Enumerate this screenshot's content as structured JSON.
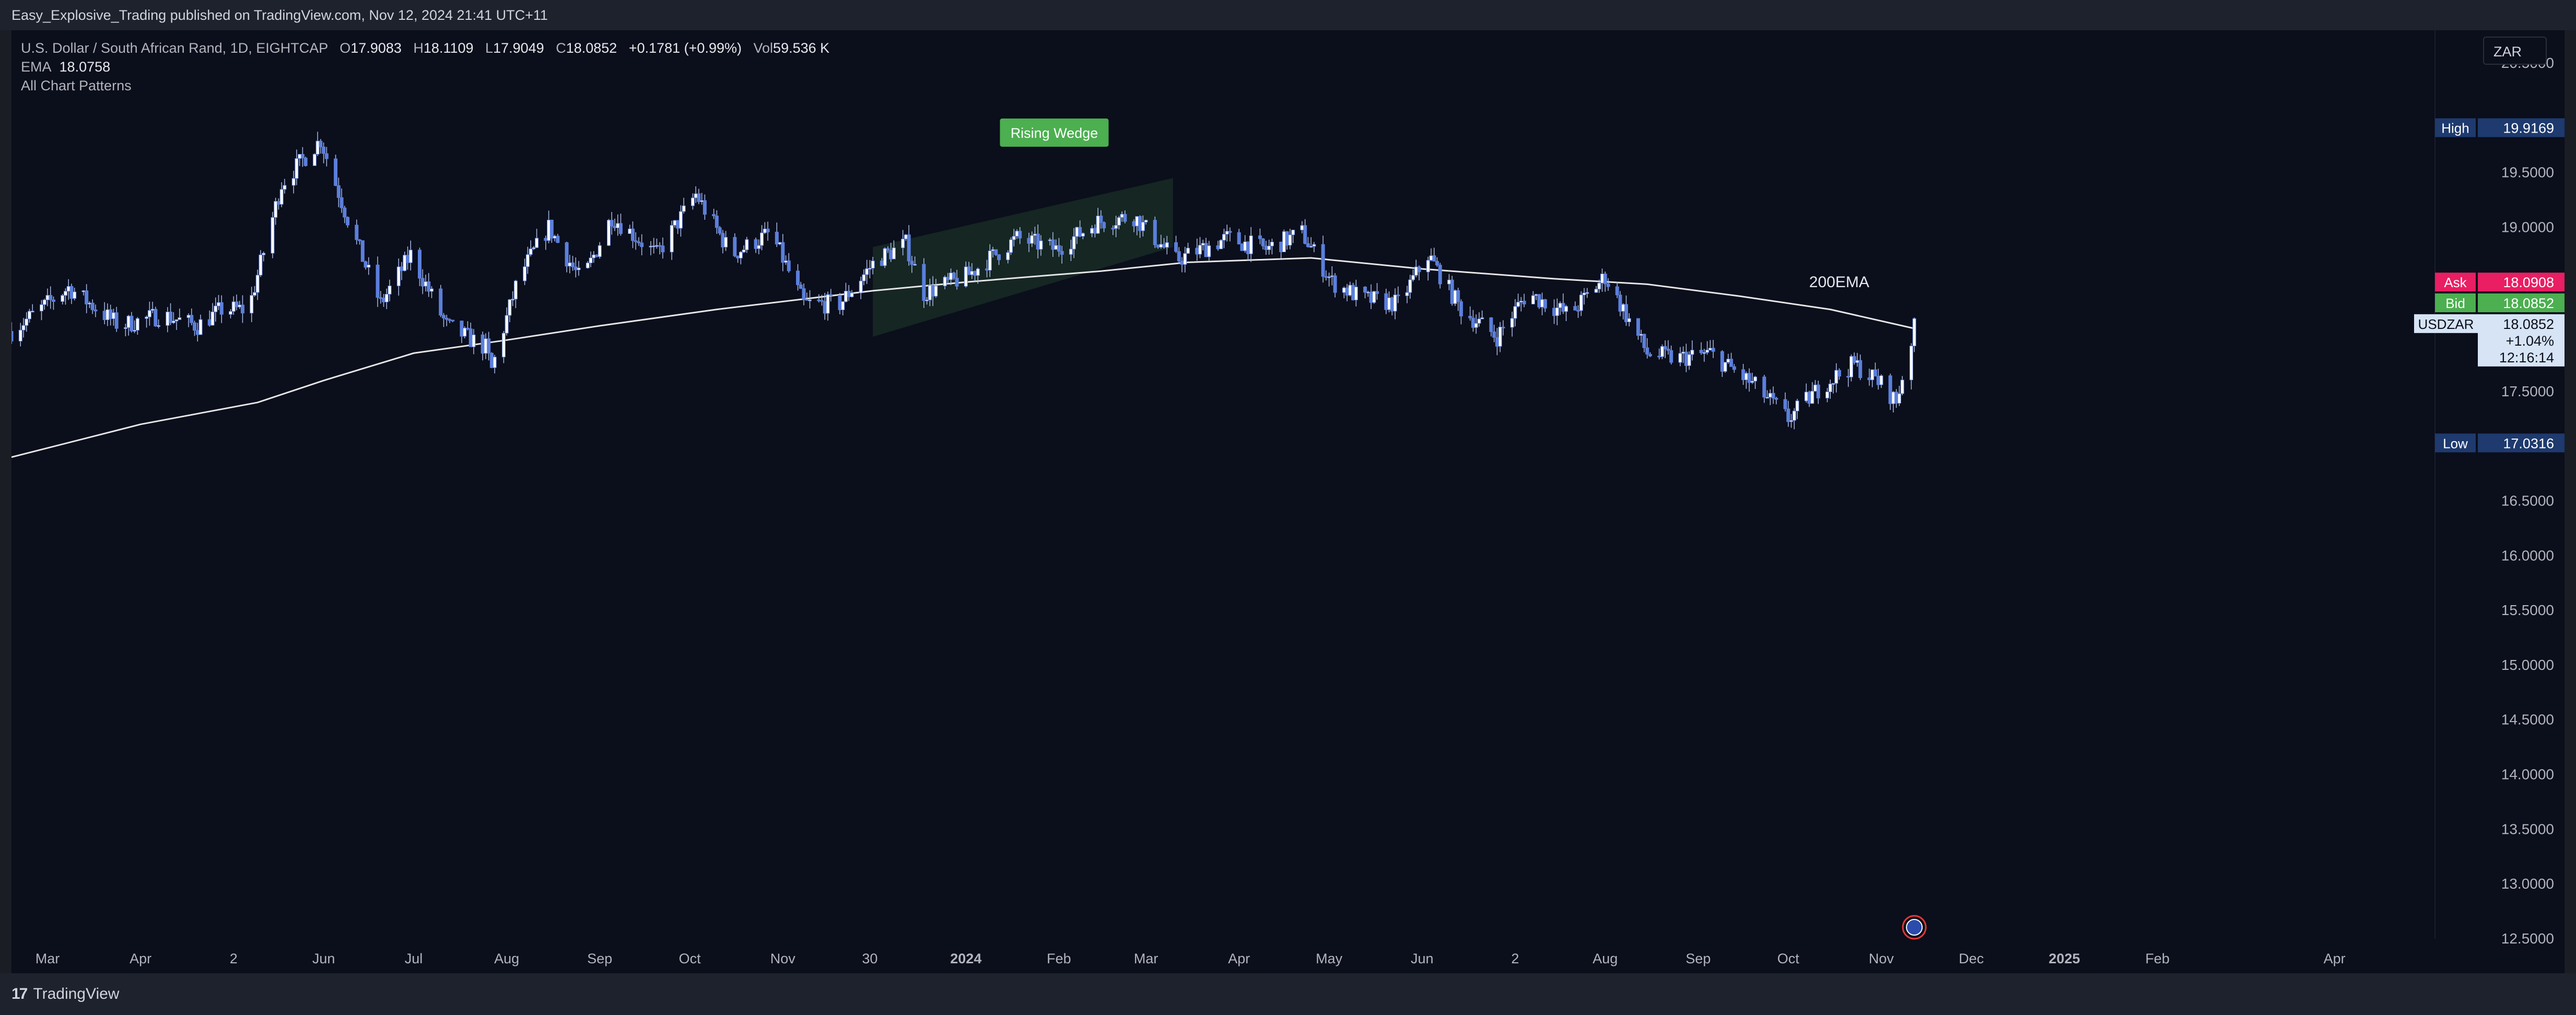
{
  "header": {
    "published_text": "Easy_Explosive_Trading published on TradingView.com, Nov 12, 2024 21:41 UTC+11"
  },
  "legend": {
    "symbol_text": "U.S. Dollar / South African Rand, 1D, EIGHTCAP",
    "open_label": "O",
    "open": "17.9083",
    "high_label": "H",
    "high": "18.1109",
    "low_label": "L",
    "low": "17.9049",
    "close_label": "C",
    "close": "18.0852",
    "change": "+0.1781 (+0.99%)",
    "vol_label": "Vol",
    "vol": "59.536 K",
    "ema_label": "EMA",
    "ema_value": "18.0758",
    "patterns_label": "All Chart Patterns"
  },
  "currency_button": "ZAR",
  "footer": {
    "brand": "TradingView",
    "logo_mark": "17"
  },
  "colors": {
    "background": "#0b0e1b",
    "candle": "#5b7fdc",
    "ema_line": "#e6e6e6",
    "wedge_fill": "#1f3a2a",
    "wedge_label_bg": "#4caf50",
    "high_tag": "#1e3a6e",
    "low_tag": "#1e3a6e",
    "ask_tag": "#e91e63",
    "bid_tag": "#4caf50",
    "price_tag": "#d6e4f5"
  },
  "chart_data": {
    "type": "candlestick",
    "symbol": "USDZAR",
    "interval": "1D",
    "ylim": [
      12.5,
      20.8
    ],
    "y_ticks": [
      "20.5000",
      "19.5000",
      "19.0000",
      "18.5000",
      "18.0000",
      "17.5000",
      "17.0000",
      "16.5000",
      "16.0000",
      "15.5000",
      "15.0000",
      "14.5000",
      "14.0000",
      "13.5000",
      "13.0000",
      "12.5000"
    ],
    "x_ticks": [
      {
        "label": "Mar",
        "bold": false
      },
      {
        "label": "Apr",
        "bold": false
      },
      {
        "label": "2",
        "bold": false
      },
      {
        "label": "Jun",
        "bold": false
      },
      {
        "label": "Jul",
        "bold": false
      },
      {
        "label": "Aug",
        "bold": false
      },
      {
        "label": "Sep",
        "bold": false
      },
      {
        "label": "Oct",
        "bold": false
      },
      {
        "label": "Nov",
        "bold": false
      },
      {
        "label": "30",
        "bold": false
      },
      {
        "label": "2024",
        "bold": true
      },
      {
        "label": "Feb",
        "bold": false
      },
      {
        "label": "Mar",
        "bold": false
      },
      {
        "label": "Apr",
        "bold": false
      },
      {
        "label": "May",
        "bold": false
      },
      {
        "label": "Jun",
        "bold": false
      },
      {
        "label": "2",
        "bold": false
      },
      {
        "label": "Aug",
        "bold": false
      },
      {
        "label": "Sep",
        "bold": false
      },
      {
        "label": "Oct",
        "bold": false
      },
      {
        "label": "Nov",
        "bold": false
      },
      {
        "label": "Dec",
        "bold": false
      },
      {
        "label": "2025",
        "bold": true
      },
      {
        "label": "Feb",
        "bold": false
      },
      {
        "label": "Apr",
        "bold": false
      }
    ],
    "x_tick_dates": [
      "2023-03-01",
      "2023-04-01",
      "2023-05-02",
      "2023-06-01",
      "2023-07-01",
      "2023-08-01",
      "2023-09-01",
      "2023-10-01",
      "2023-11-01",
      "2023-11-30",
      "2024-01-01",
      "2024-02-01",
      "2024-03-01",
      "2024-04-01",
      "2024-05-01",
      "2024-06-01",
      "2024-07-02",
      "2024-08-01",
      "2024-09-01",
      "2024-10-01",
      "2024-11-01",
      "2024-12-01",
      "2025-01-01",
      "2025-02-01",
      "2025-04-01"
    ],
    "x_range": [
      "2023-02-17",
      "2025-05-01"
    ],
    "close_path": [
      {
        "date": "2023-02-17",
        "close": 18.05
      },
      {
        "date": "2023-03-08",
        "close": 18.45
      },
      {
        "date": "2023-03-25",
        "close": 18.1
      },
      {
        "date": "2023-04-08",
        "close": 18.2
      },
      {
        "date": "2023-04-20",
        "close": 18.1
      },
      {
        "date": "2023-04-28",
        "close": 18.25
      },
      {
        "date": "2023-05-07",
        "close": 18.25
      },
      {
        "date": "2023-05-18",
        "close": 19.4
      },
      {
        "date": "2023-05-31",
        "close": 19.8
      },
      {
        "date": "2023-06-10",
        "close": 19.0
      },
      {
        "date": "2023-06-20",
        "close": 18.3
      },
      {
        "date": "2023-06-30",
        "close": 18.75
      },
      {
        "date": "2023-07-12",
        "close": 18.1
      },
      {
        "date": "2023-07-25",
        "close": 17.9
      },
      {
        "date": "2023-07-27",
        "close": 17.7
      },
      {
        "date": "2023-08-05",
        "close": 18.55
      },
      {
        "date": "2023-08-15",
        "close": 19.0
      },
      {
        "date": "2023-08-26",
        "close": 18.5
      },
      {
        "date": "2023-09-05",
        "close": 19.1
      },
      {
        "date": "2023-09-20",
        "close": 18.75
      },
      {
        "date": "2023-10-03",
        "close": 19.3
      },
      {
        "date": "2023-10-15",
        "close": 18.75
      },
      {
        "date": "2023-10-28",
        "close": 18.95
      },
      {
        "date": "2023-11-08",
        "close": 18.3
      },
      {
        "date": "2023-11-20",
        "close": 18.3
      },
      {
        "date": "2023-12-02",
        "close": 18.7
      },
      {
        "date": "2023-12-12",
        "close": 18.85
      },
      {
        "date": "2023-12-18",
        "close": 18.4
      },
      {
        "date": "2024-01-01",
        "close": 18.55
      },
      {
        "date": "2024-01-18",
        "close": 18.9
      },
      {
        "date": "2024-01-31",
        "close": 18.8
      },
      {
        "date": "2024-02-14",
        "close": 19.05
      },
      {
        "date": "2024-02-26",
        "close": 19.1
      },
      {
        "date": "2024-03-11",
        "close": 18.7
      },
      {
        "date": "2024-03-28",
        "close": 18.9
      },
      {
        "date": "2024-04-10",
        "close": 18.8
      },
      {
        "date": "2024-04-22",
        "close": 18.95
      },
      {
        "date": "2024-05-02",
        "close": 18.5
      },
      {
        "date": "2024-05-12",
        "close": 18.35
      },
      {
        "date": "2024-05-24",
        "close": 18.3
      },
      {
        "date": "2024-06-03",
        "close": 18.75
      },
      {
        "date": "2024-06-14",
        "close": 18.25
      },
      {
        "date": "2024-06-26",
        "close": 18.0
      },
      {
        "date": "2024-07-06",
        "close": 18.4
      },
      {
        "date": "2024-07-20",
        "close": 18.2
      },
      {
        "date": "2024-08-01",
        "close": 18.55
      },
      {
        "date": "2024-08-15",
        "close": 17.85
      },
      {
        "date": "2024-08-25",
        "close": 17.8
      },
      {
        "date": "2024-09-05",
        "close": 17.85
      },
      {
        "date": "2024-09-20",
        "close": 17.55
      },
      {
        "date": "2024-10-01",
        "close": 17.25
      },
      {
        "date": "2024-10-12",
        "close": 17.55
      },
      {
        "date": "2024-10-23",
        "close": 17.75
      },
      {
        "date": "2024-11-02",
        "close": 17.55
      },
      {
        "date": "2024-11-06",
        "close": 17.4
      },
      {
        "date": "2024-11-09",
        "close": 17.75
      },
      {
        "date": "2024-11-12",
        "close": 18.08
      }
    ],
    "ema_path": [
      {
        "date": "2023-02-17",
        "value": 16.9
      },
      {
        "date": "2023-04-01",
        "value": 17.2
      },
      {
        "date": "2023-05-10",
        "value": 17.4
      },
      {
        "date": "2023-06-01",
        "value": 17.6
      },
      {
        "date": "2023-07-01",
        "value": 17.85
      },
      {
        "date": "2023-08-01",
        "value": 17.97
      },
      {
        "date": "2023-09-01",
        "value": 18.1
      },
      {
        "date": "2023-10-10",
        "value": 18.25
      },
      {
        "date": "2023-12-01",
        "value": 18.42
      },
      {
        "date": "2024-01-01",
        "value": 18.5
      },
      {
        "date": "2024-02-15",
        "value": 18.6
      },
      {
        "date": "2024-03-15",
        "value": 18.68
      },
      {
        "date": "2024-04-25",
        "value": 18.72
      },
      {
        "date": "2024-06-01",
        "value": 18.62
      },
      {
        "date": "2024-07-15",
        "value": 18.53
      },
      {
        "date": "2024-08-15",
        "value": 18.48
      },
      {
        "date": "2024-09-15",
        "value": 18.37
      },
      {
        "date": "2024-10-15",
        "value": 18.25
      },
      {
        "date": "2024-11-12",
        "value": 18.0758
      }
    ],
    "annotations": {
      "pattern": {
        "label": "Rising Wedge",
        "upper": [
          {
            "date": "2023-12-01",
            "price": 18.82
          },
          {
            "date": "2024-03-10",
            "price": 19.45
          }
        ],
        "lower": [
          {
            "date": "2023-12-01",
            "price": 18.0
          },
          {
            "date": "2024-03-10",
            "price": 18.82
          }
        ]
      },
      "ema_label": {
        "text": "200EMA",
        "date": "2024-10-01",
        "price": 18.5
      }
    },
    "price_tags": {
      "high": {
        "label": "High",
        "value": "19.9169"
      },
      "ask": {
        "label": "Ask",
        "value": "18.0908"
      },
      "bid": {
        "label": "Bid",
        "value": "18.0852"
      },
      "last": {
        "symbol": "USDZAR",
        "value": "18.0852",
        "change": "+1.04%",
        "countdown": "12:16:14"
      },
      "low": {
        "label": "Low",
        "value": "17.0316"
      }
    }
  }
}
